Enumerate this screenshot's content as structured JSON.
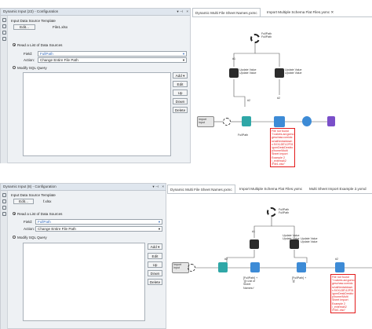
{
  "top": {
    "config": {
      "title": "Dynamic Input (22) - Configuration",
      "template_label": "Input Data Source Template",
      "edit_label": "Edit...",
      "file_value": "File1.xlsx",
      "read_list_label": "Read a List of Data Sources",
      "field_label": "Field:",
      "field_value": "FullPath",
      "action_label": "Action:",
      "action_value": "Change Entire File Path",
      "modify_sql_label": "Modify SQL Query",
      "buttons": [
        "Add",
        "Edit",
        "Up",
        "Down",
        "Delete"
      ]
    },
    "tabs": [
      "Dynamic Multi File Sheet Names.yxmc",
      "Import Multiple Schema Flat Files.yxmc"
    ],
    "canvas": {
      "import_label": "Import\nInput",
      "fullpath_anno": "FullPath\nFullPath",
      "hash1": "#1",
      "update_values": [
        "Update Value\nUpdate Value",
        "Update Value\nUpdate Value"
      ],
      "hash2": "#2",
      "hash3": "#2",
      "fullpath_label": "FullPath",
      "error": "File not found\n\"/:calves.ad.gomo\ngeschaw.com\\dc\nsc\\ali\\lentaldown\nx.f\\VXLDE\\12F01\n\\gomDeskDeskto\np\\home\\Multi\nSheet Import\nExample 2\n\\_external\\2\n\\File1.xlsx\""
    }
  },
  "bottom": {
    "config": {
      "title": "Dynamic Input (8) - Configuration",
      "template_label": "Input Data Source Template",
      "edit_label": "Edit...",
      "file_value": "f.xlsx",
      "read_list_label": "Read a List of Data Sources",
      "field_label": "Field:",
      "field_value": "FullPath",
      "action_label": "Action:",
      "action_value": "Change Entire File Path",
      "modify_sql_label": "Modify SQL Query",
      "buttons": [
        "Add",
        "Edit",
        "Up",
        "Down",
        "Delete"
      ]
    },
    "tabs": [
      "Dynamic Multi File Sheet Names.yxmc",
      "Import Multiple Schema Flat Files.yxmc",
      "Multi Sheet Import Example 2.yxmd"
    ],
    "canvas": {
      "import_label": "Import\nInput",
      "fullpath_anno": "FullPath\nFullPath",
      "hash1": "#1",
      "update_values": [
        "Update Value\nUpdate Value",
        "Update Value\nUpdate Value"
      ],
      "hash2": "#2",
      "hash3": "#2",
      "formula1": "[FullPath] +\n'|||<List of\nSheet\nNames>'",
      "formula2": "[FullPath] +\n'|||'",
      "error": "File not found\n\"/:calves.ad.gomo\ngeschaw.com\\dc\nsc\\ali\\lentaldown\nx.f\\VXLDE\\12F01\n\\gomDeskDeskto\np\\home\\Multi\nSheet Import\nExample 2\n\\_external\\2\n\\File1.xlsx\""
    }
  },
  "colors": {
    "accent": "#3d8bd6",
    "error": "#e31b1b",
    "panel": "#eef1f4"
  }
}
